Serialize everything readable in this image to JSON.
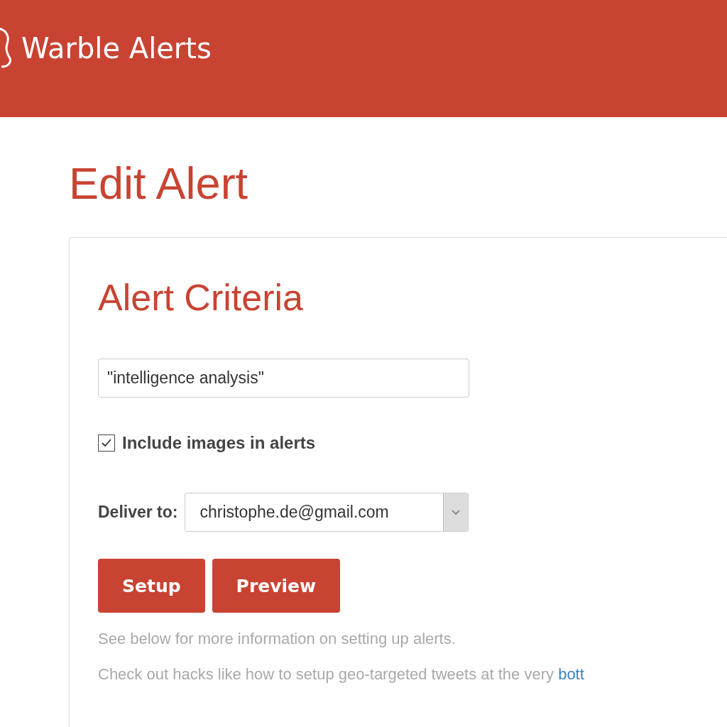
{
  "header": {
    "brand": "Warble Alerts"
  },
  "page_title": "Edit Alert",
  "card": {
    "title": "Alert Criteria",
    "query_field": {
      "value": "\"intelligence analysis\""
    },
    "include_images": {
      "label": "Include images in alerts",
      "checked": true
    },
    "deliver_to": {
      "label": "Deliver to:",
      "value": "christophe.de@gmail.com"
    },
    "buttons": [
      "Setup",
      "Preview"
    ],
    "help_text": "See below for more information on setting up alerts.",
    "hacks_text": {
      "text": "Check out hacks like how to setup geo-targeted tweets at the very ",
      "link": "bott"
    }
  }
}
